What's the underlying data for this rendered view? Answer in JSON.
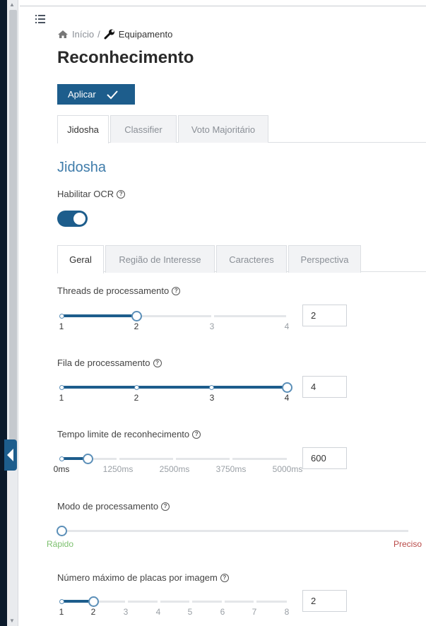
{
  "colors": {
    "accent": "#1d5d8c",
    "title": "#3f7caa",
    "fast": "#7cc06e",
    "precise": "#b94a48"
  },
  "breadcrumb": {
    "home": "Início",
    "separator": "/",
    "current": "Equipamento"
  },
  "page": {
    "title": "Reconhecimento"
  },
  "apply_button": {
    "label": "Aplicar"
  },
  "main_tabs": [
    {
      "label": "Jidosha",
      "active": true
    },
    {
      "label": "Classifier",
      "active": false
    },
    {
      "label": "Voto Majoritário",
      "active": false
    }
  ],
  "section": {
    "title": "Jidosha",
    "ocr_label": "Habilitar OCR",
    "ocr_enabled": true
  },
  "sub_tabs": [
    {
      "label": "Geral",
      "active": true
    },
    {
      "label": "Região de Interesse",
      "active": false
    },
    {
      "label": "Caracteres",
      "active": false
    },
    {
      "label": "Perspectiva",
      "active": false
    }
  ],
  "threads": {
    "label": "Threads de processamento",
    "marks": [
      "1",
      "2",
      "3",
      "4"
    ],
    "value": "2"
  },
  "queue": {
    "label": "Fila de processamento",
    "marks": [
      "1",
      "2",
      "3",
      "4"
    ],
    "value": "4"
  },
  "timeout": {
    "label": "Tempo limite de reconhecimento",
    "marks": [
      "0ms",
      "1250ms",
      "2500ms",
      "3750ms",
      "5000ms"
    ],
    "value": "600"
  },
  "mode": {
    "label": "Modo de processamento",
    "left": "Rápido",
    "right": "Preciso",
    "level": 0
  },
  "plates": {
    "label": "Número máximo de placas por imagem",
    "marks": [
      "1",
      "2",
      "3",
      "4",
      "5",
      "6",
      "7",
      "8"
    ],
    "value": "2"
  }
}
